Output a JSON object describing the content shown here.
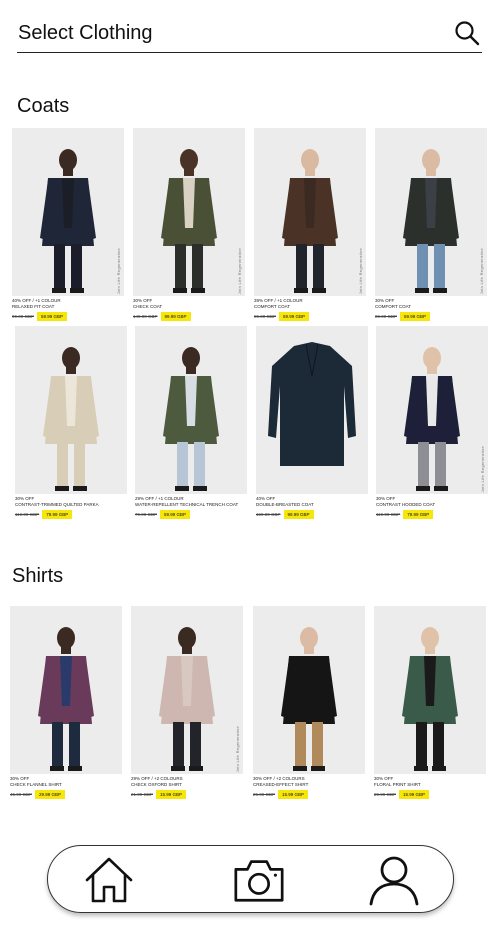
{
  "search": {
    "label": "Select Clothing",
    "icon": "search-icon"
  },
  "sections": [
    {
      "title": "Coats",
      "products": [
        {
          "promo": "40% OFF / +1 COLOUR",
          "name": "RELAXED FIT COAT",
          "old_price": "99.00 GBP",
          "new_price": "59.99 GBP",
          "side_tag": "Join Life  Regenerative",
          "coat": "#1f2638",
          "trousers": "#1b1e2a",
          "skin": "#3b2a22",
          "inner": "#1c1e27"
        },
        {
          "promo": "30% OFF",
          "name": "CHECK COAT",
          "old_price": "149.00 GBP",
          "new_price": "99.99 GBP",
          "side_tag": "Join Life  Regenerative",
          "coat": "#4a5036",
          "trousers": "#2b2e2a",
          "skin": "#4a3226",
          "inner": "#d9d2c2"
        },
        {
          "promo": "39% OFF / +1 COLOUR",
          "name": "COMFORT COAT",
          "old_price": "89.00 GBP",
          "new_price": "59.99 GBP",
          "side_tag": "Join Life  Regenerative",
          "coat": "#4b3227",
          "trousers": "#22242c",
          "skin": "#d9b9a0",
          "inner": "#3a2a22"
        },
        {
          "promo": "30% OFF",
          "name": "COMFORT COAT",
          "old_price": "89.00 GBP",
          "new_price": "59.99 GBP",
          "side_tag": "Join Life  Regenerative",
          "coat": "#2b302c",
          "trousers": "#6f8fb3",
          "skin": "#dcbba4",
          "inner": "#3b3f46"
        },
        {
          "promo": "30% OFF",
          "name": "CONTRAST-TRIMMED QUILTED PARKA",
          "old_price": "119.00 GBP",
          "new_price": "79.99 GBP",
          "side_tag": "",
          "coat": "#d8cdb6",
          "trousers": "#d8cdb6",
          "skin": "#3a2a22",
          "inner": "#ece6d8"
        },
        {
          "promo": "29% OFF / +1 COLOUR",
          "name": "WATER-REPELLENT TECHNICAL TRENCH COAT",
          "old_price": "79.00 GBP",
          "new_price": "59.99 GBP",
          "side_tag": "",
          "coat": "#4e5a3e",
          "trousers": "#b7c6d6",
          "skin": "#3a2a22",
          "inner": "#d7dde3"
        },
        {
          "promo": "40% OFF",
          "name": "DOUBLE-BREASTED COAT",
          "old_price": "159.00 GBP",
          "new_price": "99.99 GBP",
          "side_tag": "",
          "coat": "#1c2a38",
          "trousers": "#1c2a38",
          "skin": "#ececec",
          "inner": "#1c2a38"
        },
        {
          "promo": "30% OFF",
          "name": "CONTRAST HOODED COAT",
          "old_price": "119.00 GBP",
          "new_price": "79.99 GBP",
          "side_tag": "Join Life  Regenerative",
          "coat": "#1d2038",
          "trousers": "#8e8f94",
          "skin": "#e0c2a8",
          "inner": "#e9e9e9"
        }
      ]
    },
    {
      "title": "Shirts",
      "products": [
        {
          "promo": "30% OFF",
          "name": "CHECK FLANNEL SHIRT",
          "old_price": "45.99 GBP",
          "new_price": "29.99 GBP",
          "side_tag": "",
          "coat": "#6a3a5a",
          "trousers": "#1e2a3e",
          "skin": "#3a2a22",
          "inner": "#2a3a6a"
        },
        {
          "promo": "29% OFF / +2 COLOURS",
          "name": "CHECK OXFORD SHIRT",
          "old_price": "21.99 GBP",
          "new_price": "15.99 GBP",
          "side_tag": "Join Life  Regenerative",
          "coat": "#cdb7b0",
          "trousers": "#22242a",
          "skin": "#3a2a22",
          "inner": "#d9c8c2"
        },
        {
          "promo": "30% OFF / +2 COLOURS",
          "name": "CREASED-EFFECT SHIRT",
          "old_price": "25.99 GBP",
          "new_price": "15.99 GBP",
          "side_tag": "",
          "coat": "#151515",
          "trousers": "#b08a5a",
          "skin": "#dcbba4",
          "inner": "#151515"
        },
        {
          "promo": "30% OFF",
          "name": "FLORAL PRINT SHIRT",
          "old_price": "29.99 GBP",
          "new_price": "15.99 GBP",
          "side_tag": "",
          "coat": "#3a5a4a",
          "trousers": "#1a1a1a",
          "skin": "#e0c2a8",
          "inner": "#1a1a1a"
        }
      ]
    }
  ],
  "bottom_nav": [
    {
      "id": "home",
      "icon": "home-icon"
    },
    {
      "id": "camera",
      "icon": "camera-icon"
    },
    {
      "id": "profile",
      "icon": "profile-icon"
    }
  ]
}
